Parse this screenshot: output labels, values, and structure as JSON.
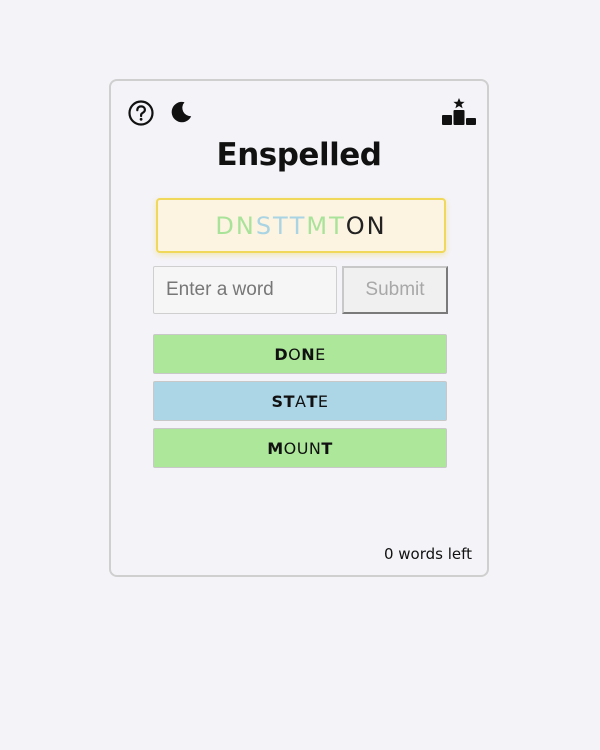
{
  "header": {
    "help_icon": "help-circle-icon",
    "theme_icon": "moon-icon",
    "leaderboard_icon": "leaderboard-podium-icon"
  },
  "title": "Enspelled",
  "letters": [
    {
      "char": "D",
      "color": "#a9e39a"
    },
    {
      "char": "N",
      "color": "#a9e39a"
    },
    {
      "char": "S",
      "color": "#a8d4e4"
    },
    {
      "char": "T",
      "color": "#a8d4e4"
    },
    {
      "char": "T",
      "color": "#a8d4e4"
    },
    {
      "char": "M",
      "color": "#a9e39a"
    },
    {
      "char": "T",
      "color": "#a9e39a"
    },
    {
      "char": "O",
      "color": "#222222"
    },
    {
      "char": "N",
      "color": "#222222"
    }
  ],
  "input": {
    "placeholder": "Enter a word",
    "value": ""
  },
  "submit_label": "Submit",
  "words": [
    {
      "word": "DONE",
      "color": "#ace79a",
      "letters": [
        {
          "char": "D",
          "bold": true
        },
        {
          "char": "O",
          "bold": false
        },
        {
          "char": "N",
          "bold": true
        },
        {
          "char": "E",
          "bold": false
        }
      ]
    },
    {
      "word": "STATE",
      "color": "#acd6e6",
      "letters": [
        {
          "char": "S",
          "bold": true
        },
        {
          "char": "T",
          "bold": true
        },
        {
          "char": "A",
          "bold": false
        },
        {
          "char": "T",
          "bold": true
        },
        {
          "char": "E",
          "bold": false
        }
      ]
    },
    {
      "word": "MOUNT",
      "color": "#ace79a",
      "letters": [
        {
          "char": "M",
          "bold": true
        },
        {
          "char": "O",
          "bold": false
        },
        {
          "char": "U",
          "bold": false
        },
        {
          "char": "N",
          "bold": false
        },
        {
          "char": "T",
          "bold": true
        }
      ]
    }
  ],
  "status": {
    "words_left": "0 words left"
  }
}
